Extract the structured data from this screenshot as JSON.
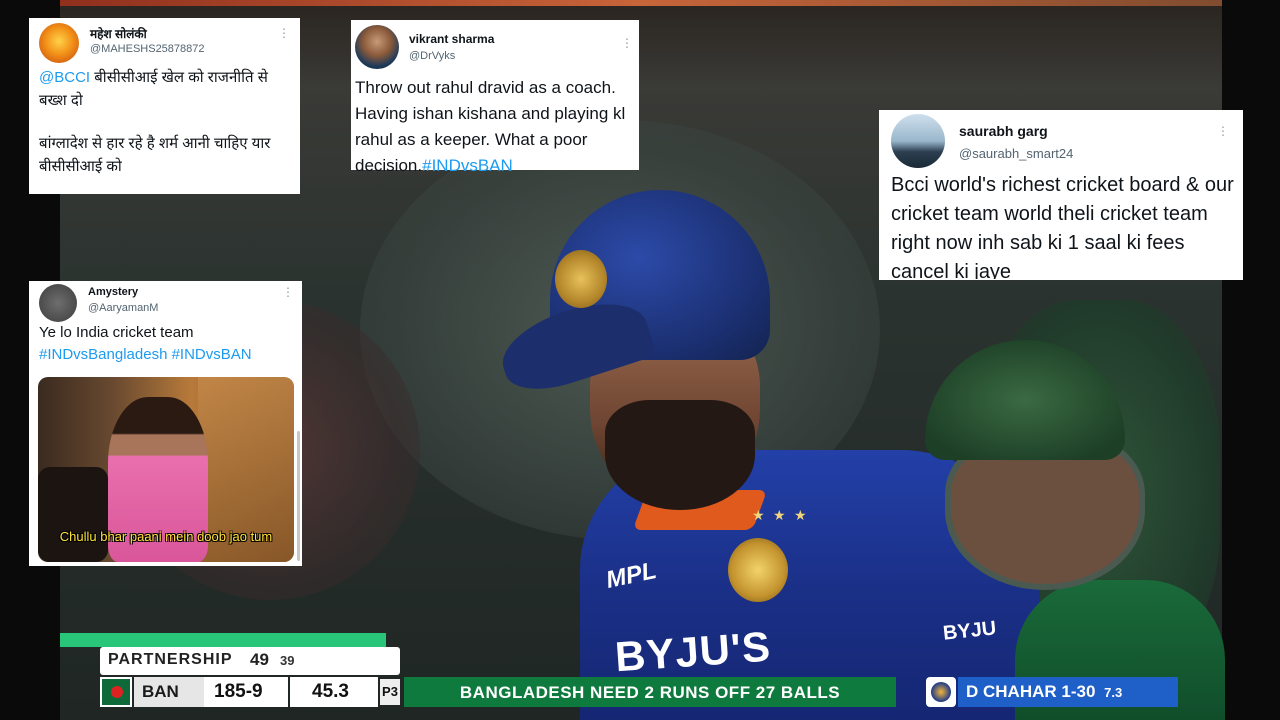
{
  "tweets": [
    {
      "name": "महेश सोलंकी",
      "handle": "@MAHESHS25878872",
      "mention": "@BCCI",
      "text_line1": " बीसीसीआई  खेल को राजनीति से बख्श दो",
      "text_line2": " बांग्लादेश से हार रहे है शर्म आनी चाहिए यार बीसीसीआई को",
      "more_icon": "ellipsis-vertical-icon"
    },
    {
      "name": "vikrant sharma",
      "handle": "@DrVyks",
      "text": "Throw out rahul dravid as a coach. Having ishan kishana and playing kl rahul as a keeper. What a poor decision.",
      "hashtag": "#INDvsBAN",
      "more_icon": "ellipsis-vertical-icon"
    },
    {
      "name": "saurabh garg",
      "handle": "@saurabh_smart24",
      "text": "Bcci world's richest cricket board & our cricket team world theli cricket team right now inh sab ki 1 saal ki fees cancel ki jaye",
      "more_icon": "ellipsis-vertical-icon"
    },
    {
      "name": "Amystery",
      "handle": "@AaryamanM",
      "text": "Ye lo India cricket team",
      "hashtags": "#INDvsBangladesh #INDvsBAN",
      "meme_caption": "Chullu bhar paani mein doob jao tum",
      "more_icon": "ellipsis-vertical-icon"
    }
  ],
  "broadcast": {
    "partnership_label": "PARTNERSHIP",
    "partnership_runs": "49",
    "partnership_balls": "39",
    "team": "BAN",
    "score": "185-9",
    "overs": "45.3",
    "powerplay": "P3",
    "equation": "BANGLADESH NEED 2 RUNS OFF 27 BALLS",
    "bowler": "D CHAHAR",
    "bowler_figures": "1-30",
    "bowler_overs": "7.3"
  },
  "jersey": {
    "sponsor": "BYJU'S",
    "sponsor_small": "BYJU",
    "kit_brand": "MPL",
    "stars": "★ ★ ★"
  },
  "colors": {
    "link": "#1d9bf0",
    "jersey_blue": "#1a2f86",
    "scorebar_green": "#0f7a3e",
    "bowler_blue": "#1f5fc8"
  }
}
